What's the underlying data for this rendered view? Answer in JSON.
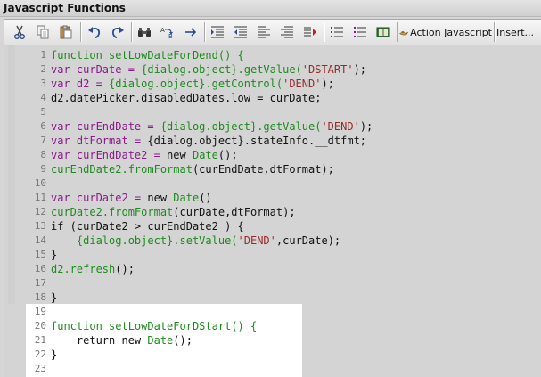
{
  "window": {
    "title": "Javascript Functions"
  },
  "toolbar": {
    "action_javascript_label": "Action Javascript",
    "insert_label": "Insert..."
  },
  "editor": {
    "lines": [
      {
        "n": "1",
        "tokens": [
          {
            "t": "function ",
            "c": "fn"
          },
          {
            "t": "setLowDateForDend",
            "c": "fn"
          },
          {
            "t": "() {",
            "c": "fn"
          }
        ]
      },
      {
        "n": "2",
        "tokens": [
          {
            "t": "var ",
            "c": "kw"
          },
          {
            "t": "curDate = ",
            "c": "kw"
          },
          {
            "t": "{dialog.object}",
            "c": "fn"
          },
          {
            "t": ".getValue(",
            "c": "fn"
          },
          {
            "t": "'DSTART'",
            "c": "str"
          },
          {
            "t": ");",
            "c": "plain"
          }
        ]
      },
      {
        "n": "3",
        "tokens": [
          {
            "t": "var ",
            "c": "kw"
          },
          {
            "t": "d2 = ",
            "c": "kw"
          },
          {
            "t": "{dialog.object}",
            "c": "fn"
          },
          {
            "t": ".getControl(",
            "c": "fn"
          },
          {
            "t": "'DEND'",
            "c": "str"
          },
          {
            "t": ");",
            "c": "plain"
          }
        ]
      },
      {
        "n": "4",
        "tokens": [
          {
            "t": "d2.datePicker.disabledDates.low = curDate;",
            "c": "plain"
          }
        ]
      },
      {
        "n": "5",
        "tokens": []
      },
      {
        "n": "6",
        "tokens": [
          {
            "t": "var ",
            "c": "kw"
          },
          {
            "t": "curEndDate = ",
            "c": "kw"
          },
          {
            "t": "{dialog.object}",
            "c": "fn"
          },
          {
            "t": ".getValue(",
            "c": "fn"
          },
          {
            "t": "'DEND'",
            "c": "str"
          },
          {
            "t": ");",
            "c": "plain"
          }
        ]
      },
      {
        "n": "7",
        "tokens": [
          {
            "t": "var ",
            "c": "kw"
          },
          {
            "t": "dtFormat = ",
            "c": "kw"
          },
          {
            "t": "{dialog.object}.stateInfo.__dtfmt;",
            "c": "plain"
          }
        ]
      },
      {
        "n": "8",
        "tokens": [
          {
            "t": "var ",
            "c": "kw"
          },
          {
            "t": "curEndDate2 = ",
            "c": "kw"
          },
          {
            "t": "new ",
            "c": "plain"
          },
          {
            "t": "Date",
            "c": "fn"
          },
          {
            "t": "();",
            "c": "plain"
          }
        ]
      },
      {
        "n": "9",
        "tokens": [
          {
            "t": "curEndDate2.fromFormat",
            "c": "fn"
          },
          {
            "t": "(curEndDate,dtFormat);",
            "c": "plain"
          }
        ]
      },
      {
        "n": "10",
        "tokens": []
      },
      {
        "n": "11",
        "tokens": [
          {
            "t": "var ",
            "c": "kw"
          },
          {
            "t": "curDate2 = ",
            "c": "kw"
          },
          {
            "t": "new ",
            "c": "plain"
          },
          {
            "t": "Date",
            "c": "fn"
          },
          {
            "t": "()",
            "c": "plain"
          }
        ]
      },
      {
        "n": "12",
        "tokens": [
          {
            "t": "curDate2.fromFormat",
            "c": "fn"
          },
          {
            "t": "(curDate,dtFormat);",
            "c": "plain"
          }
        ]
      },
      {
        "n": "13",
        "tokens": [
          {
            "t": "if (curDate2 > curEndDate2 ) {",
            "c": "plain"
          }
        ]
      },
      {
        "n": "14",
        "tokens": [
          {
            "t": "    {dialog.object}",
            "c": "fn"
          },
          {
            "t": ".setValue(",
            "c": "fn"
          },
          {
            "t": "'DEND'",
            "c": "str"
          },
          {
            "t": ",curDate);",
            "c": "plain"
          }
        ]
      },
      {
        "n": "15",
        "tokens": [
          {
            "t": "}",
            "c": "plain"
          }
        ]
      },
      {
        "n": "16",
        "tokens": [
          {
            "t": "d2.refresh",
            "c": "fn"
          },
          {
            "t": "();",
            "c": "plain"
          }
        ]
      },
      {
        "n": "17",
        "tokens": []
      },
      {
        "n": "18",
        "tokens": [
          {
            "t": "}",
            "c": "plain"
          }
        ]
      },
      {
        "n": "19",
        "tokens": []
      },
      {
        "n": "20",
        "tokens": [
          {
            "t": "function ",
            "c": "fn"
          },
          {
            "t": "setLowDateForDStart",
            "c": "fn"
          },
          {
            "t": "() {",
            "c": "fn"
          }
        ]
      },
      {
        "n": "21",
        "tokens": [
          {
            "t": "    return new ",
            "c": "plain"
          },
          {
            "t": "Date",
            "c": "fn"
          },
          {
            "t": "();",
            "c": "plain"
          }
        ]
      },
      {
        "n": "22",
        "tokens": [
          {
            "t": "}",
            "c": "plain"
          }
        ]
      },
      {
        "n": "23",
        "tokens": []
      }
    ]
  },
  "colors": {
    "keyword": "#8a1a8a",
    "function": "#1e8a1e",
    "string": "#9a2a2a",
    "plain": "#111111"
  },
  "icons": [
    "cut-icon",
    "copy-icon",
    "paste-icon",
    "undo-icon",
    "redo-icon",
    "find-icon",
    "replace-icon",
    "goto-icon",
    "indent-icon",
    "outdent-icon",
    "align-icon",
    "align-right-icon",
    "comment-icon",
    "list-icon",
    "list-alt-icon",
    "book-icon",
    "lamp-icon"
  ]
}
